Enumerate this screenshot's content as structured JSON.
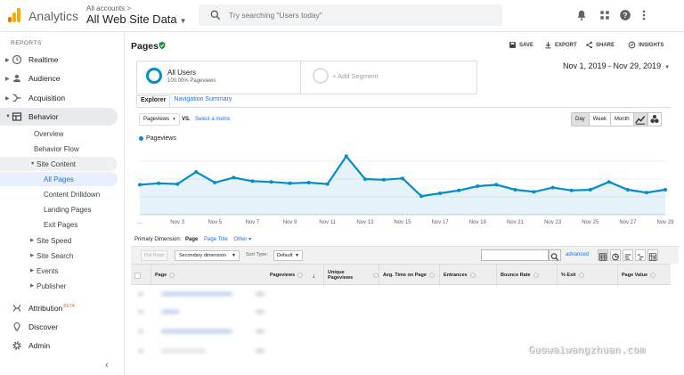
{
  "header": {
    "app_name": "Analytics",
    "account_crumb": "All accounts >",
    "view_name": "All Web Site Data",
    "search_placeholder": "Try searching \"Users today\""
  },
  "sidebar": {
    "section_label": "REPORTS",
    "items": [
      {
        "label": "Realtime",
        "icon": "clock-icon"
      },
      {
        "label": "Audience",
        "icon": "person-icon"
      },
      {
        "label": "Acquisition",
        "icon": "acquisition-icon"
      },
      {
        "label": "Behavior",
        "icon": "behavior-icon"
      }
    ],
    "behavior_sub": [
      "Overview",
      "Behavior Flow",
      "Site Content"
    ],
    "site_content_sub": [
      "All Pages",
      "Content Drilldown",
      "Landing Pages",
      "Exit Pages"
    ],
    "behavior_more": [
      "Site Speed",
      "Site Search",
      "Events",
      "Publisher"
    ],
    "bottom": [
      {
        "label": "Attribution",
        "badge": "BETA",
        "icon": "attribution-icon"
      },
      {
        "label": "Discover",
        "icon": "lightbulb-icon"
      },
      {
        "label": "Admin",
        "icon": "gear-icon"
      }
    ]
  },
  "main": {
    "title": "Pages",
    "actions": [
      "SAVE",
      "EXPORT",
      "SHARE",
      "INSIGHTS"
    ],
    "segment": {
      "name": "All Users",
      "sub": "100.00% Pageviews",
      "add": "+ Add Segment"
    },
    "date_range": "Nov 1, 2019 - Nov 29, 2019",
    "tabs": [
      "Explorer",
      "Navigation Summary"
    ],
    "metric": "Pageviews",
    "vs": "VS.",
    "select_metric": "Select a metric",
    "periods": [
      "Day",
      "Week",
      "Month"
    ],
    "primary_dimension": {
      "label": "Primary Dimension:",
      "current": "Page",
      "others": [
        "Page Title",
        "Other"
      ]
    },
    "toolbar": {
      "plot_rows": "Plot Rows",
      "secondary_dimension": "Secondary dimension",
      "sort_type_label": "Sort Type:",
      "sort_type": "Default",
      "advanced": "advanced"
    },
    "table_headers": [
      "Page",
      "Pageviews",
      "Unique Pageviews",
      "Avg. Time on Page",
      "Entrances",
      "Bounce Rate",
      "% Exit",
      "Page Value"
    ]
  },
  "chart_data": {
    "type": "area",
    "title": "",
    "legend": [
      "Pageviews"
    ],
    "color": "#058dc7",
    "x": [
      "Nov 1",
      "Nov 2",
      "Nov 3",
      "Nov 4",
      "Nov 5",
      "Nov 6",
      "Nov 7",
      "Nov 8",
      "Nov 9",
      "Nov 10",
      "Nov 11",
      "Nov 12",
      "Nov 13",
      "Nov 14",
      "Nov 15",
      "Nov 16",
      "Nov 17",
      "Nov 18",
      "Nov 19",
      "Nov 20",
      "Nov 21",
      "Nov 22",
      "Nov 23",
      "Nov 24",
      "Nov 25",
      "Nov 26",
      "Nov 27",
      "Nov 28",
      "Nov 29"
    ],
    "x_tick_labels": [
      "...",
      "Nov 3",
      "Nov 5",
      "Nov 7",
      "Nov 9",
      "Nov 11",
      "Nov 13",
      "Nov 15",
      "Nov 17",
      "Nov 19",
      "Nov 21",
      "Nov 23",
      "Nov 25",
      "Nov 27",
      "Nov 29"
    ],
    "series": [
      {
        "name": "Pageviews",
        "values": [
          42,
          44,
          43,
          60,
          45,
          52,
          47,
          46,
          44,
          45,
          43,
          82,
          50,
          49,
          51,
          26,
          30,
          34,
          40,
          42,
          35,
          32,
          38,
          34,
          35,
          46,
          35,
          31,
          35
        ]
      }
    ],
    "ylim": [
      0,
      100
    ],
    "grid": true,
    "legend_position": "top-left"
  },
  "watermark": "Guowaiwangzhuan.com"
}
